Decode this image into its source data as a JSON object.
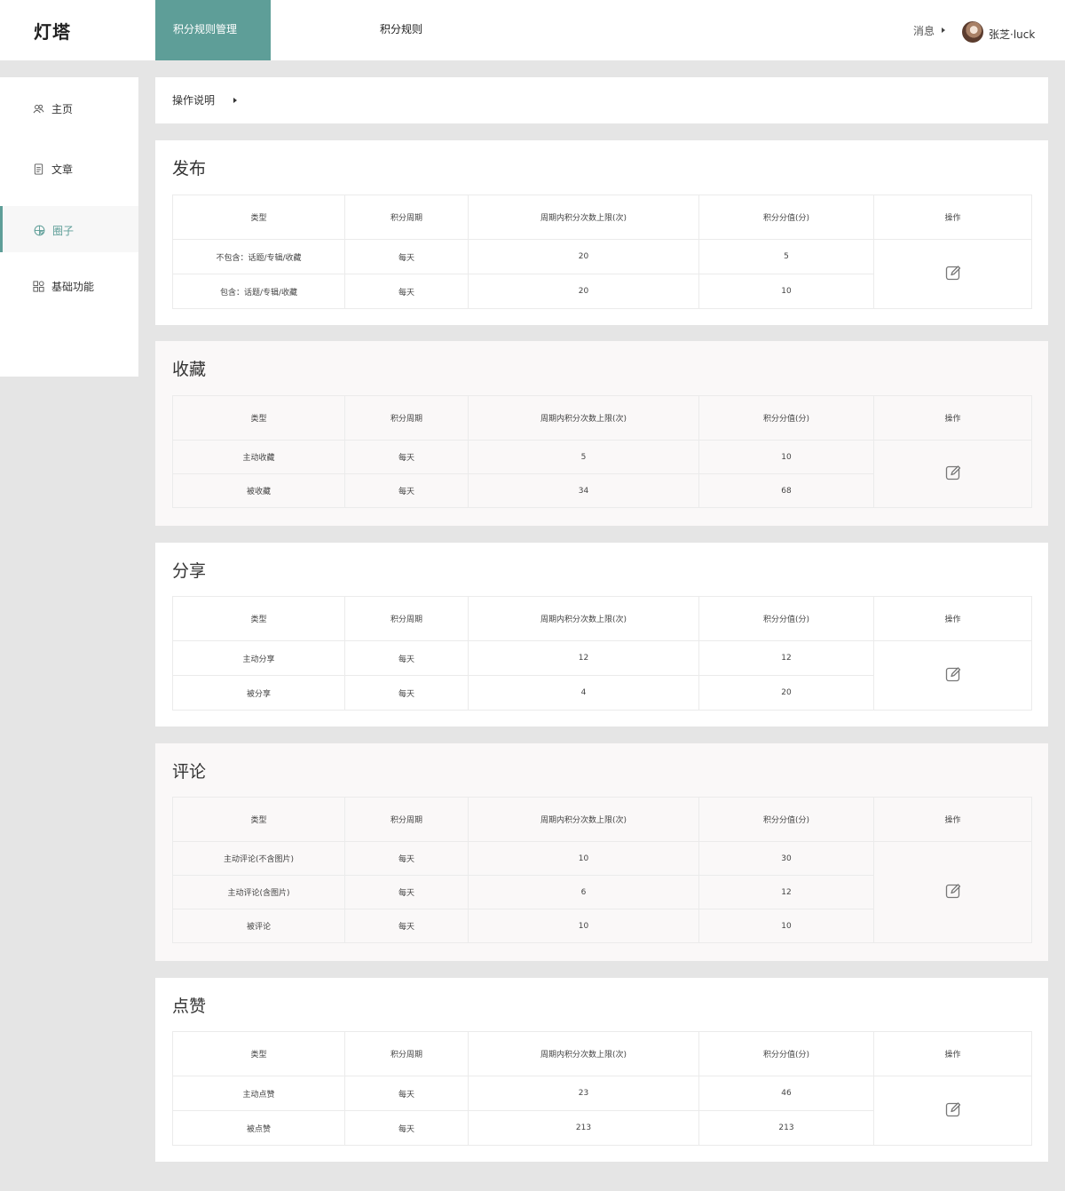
{
  "header": {
    "logo": "灯塔",
    "tab_active": "积分规则管理",
    "tab": "积分规则",
    "messages": "消息",
    "username": "张芝·luck"
  },
  "sidebar": {
    "items": [
      {
        "label": "主页",
        "icon": "users-icon"
      },
      {
        "label": "文章",
        "icon": "document-icon"
      },
      {
        "label": "圈子",
        "icon": "circle-icon",
        "active": true
      },
      {
        "label": "基础功能",
        "icon": "grid-icon"
      }
    ]
  },
  "info_bar": {
    "label": "操作说明"
  },
  "columns": [
    "类型",
    "积分周期",
    "周期内积分次数上限(次)",
    "积分分值(分)",
    "操作"
  ],
  "sections": [
    {
      "title": "发布",
      "rows": [
        {
          "type": "不包含：话题/专辑/收藏",
          "period": "每天",
          "limit": "20",
          "points": "5"
        },
        {
          "type": "包含：话题/专辑/收藏",
          "period": "每天",
          "limit": "20",
          "points": "10"
        }
      ]
    },
    {
      "title": "收藏",
      "rows": [
        {
          "type": "主动收藏",
          "period": "每天",
          "limit": "5",
          "points": "10"
        },
        {
          "type": "被收藏",
          "period": "每天",
          "limit": "34",
          "points": "68"
        }
      ]
    },
    {
      "title": "分享",
      "rows": [
        {
          "type": "主动分享",
          "period": "每天",
          "limit": "12",
          "points": "12"
        },
        {
          "type": "被分享",
          "period": "每天",
          "limit": "4",
          "points": "20"
        }
      ]
    },
    {
      "title": "评论",
      "rows": [
        {
          "type": "主动评论(不含图片)",
          "period": "每天",
          "limit": "10",
          "points": "30"
        },
        {
          "type": "主动评论(含图片)",
          "period": "每天",
          "limit": "6",
          "points": "12"
        },
        {
          "type": "被评论",
          "period": "每天",
          "limit": "10",
          "points": "10"
        }
      ]
    },
    {
      "title": "点赞",
      "rows": [
        {
          "type": "主动点赞",
          "period": "每天",
          "limit": "23",
          "points": "46"
        },
        {
          "type": "被点赞",
          "period": "每天",
          "limit": "213",
          "points": "213"
        }
      ]
    }
  ],
  "colors": {
    "accent": "#5e9e98",
    "background": "#e5e5e5"
  },
  "icons": {
    "edit": "edit-icon"
  }
}
